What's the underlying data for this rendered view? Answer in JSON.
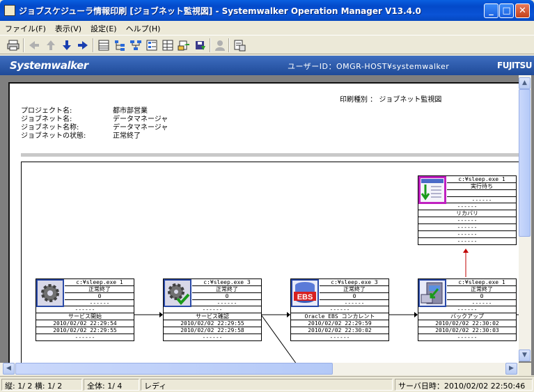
{
  "window": {
    "title": "ジョブスケジューラ情報印刷 [ジョブネット監視図] - Systemwalker Operation Manager  V13.4.0"
  },
  "menu": [
    "ファイル(F)",
    "表示(V)",
    "設定(E)",
    "ヘルプ(H)"
  ],
  "banner": {
    "logo": "Systemwalker",
    "user": "ユーザーID：OMGR-HOST¥systemwalker",
    "vendor": "FUJITSU"
  },
  "report": {
    "print_type": "印刷種別 ： ジョブネット監視図",
    "fields": [
      {
        "label": "プロジェクト名:",
        "value": "都市部営業"
      },
      {
        "label": "ジョブネット名:",
        "value": "データマネージャ"
      },
      {
        "label": "ジョブネット名称:",
        "value": "データマネージャ"
      },
      {
        "label": "ジョブネットの状態:",
        "value": "正常終了"
      }
    ]
  },
  "jobs": [
    {
      "icon": "gear-icon",
      "command": "c:¥sleep.exe 1",
      "status": "正常終了",
      "code": "0",
      "dash1": "------",
      "dash2": "------",
      "name": "サービス開始",
      "start": "2010/02/02 22:29:54",
      "end": "2010/02/02 22:29:55",
      "dash3": "------"
    },
    {
      "icon": "gear-check-icon",
      "command": "c:¥sleep.exe 3",
      "status": "正常終了",
      "code": "0",
      "dash1": "------",
      "dash2": "------",
      "name": "サービス確認",
      "start": "2010/02/02 22:29:55",
      "end": "2010/02/02 22:29:58",
      "dash3": "------"
    },
    {
      "icon": "ebs-icon",
      "ebs_text": "EBS",
      "command": "c:¥sleep.exe 3",
      "status": "正常終了",
      "code": "0",
      "dash1": "------",
      "dash2": "------",
      "name": "Oracle EBS コンカレント",
      "start": "2010/02/02 22:29:59",
      "end": "2010/02/02 22:30:02",
      "dash3": "------"
    },
    {
      "icon": "backup-icon",
      "command": "c:¥sleep.exe 1",
      "status": "正常終了",
      "code": "0",
      "dash1": "------",
      "dash2": "------",
      "name": "バックアップ",
      "start": "2010/02/02 22:30:02",
      "end": "2010/02/02 22:30:03",
      "dash3": "------"
    },
    {
      "icon": "recovery-icon",
      "command": "c:¥sleep.exe 1",
      "status": "実行待ち",
      "code": "",
      "dash1": "------",
      "dash2": "------",
      "name": "リカバリ",
      "start": "------",
      "end": "------",
      "dash3": "------",
      "dash4": "------"
    }
  ],
  "status": {
    "page": "縦: 1/ 2 横: 1/ 2",
    "total": "全体:   1/   4",
    "ready": "レディ",
    "server_time": "サーバ日時：2010/02/02 22:50:46"
  }
}
